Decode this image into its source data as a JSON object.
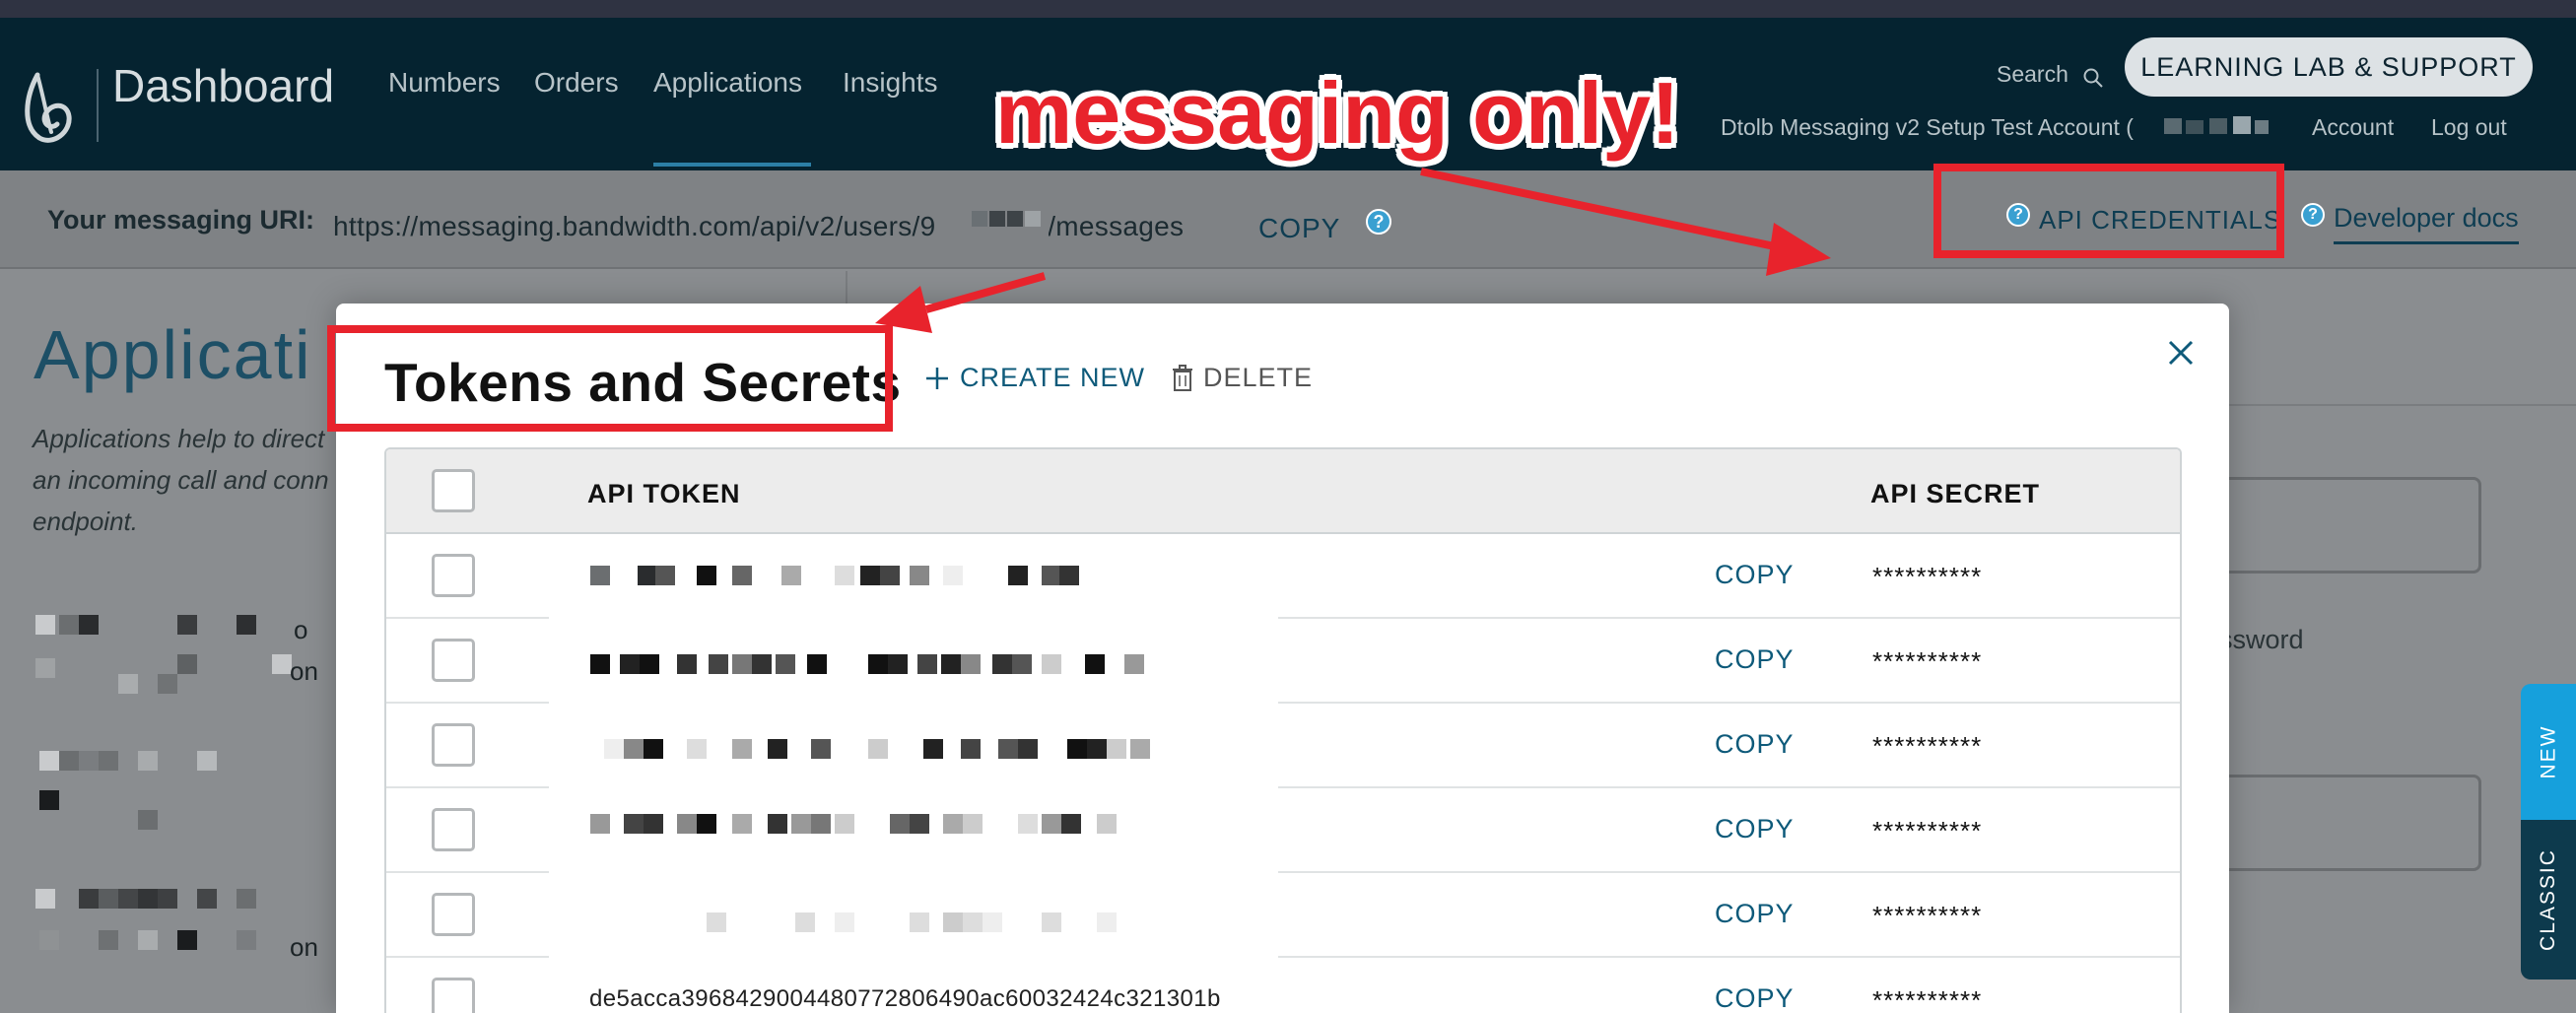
{
  "topnav": {
    "brand": "Dashboard",
    "items": [
      "Numbers",
      "Orders",
      "Applications",
      "Insights"
    ],
    "active_item": "Applications",
    "search_label": "Search",
    "learning_button": "LEARNING LAB & SUPPORT",
    "account_name": "Dtolb Messaging v2 Setup Test Account (",
    "account_link": "Account",
    "logout_link": "Log out"
  },
  "uri_bar": {
    "label": "Your messaging URI:",
    "uri_start": "https://messaging.bandwidth.com/api/v2/users/9",
    "uri_end": "78/messages",
    "copy_label": "COPY",
    "api_credentials": "API CREDENTIALS",
    "developer_docs": "Developer docs"
  },
  "background_page": {
    "title": "Applicati",
    "description": "Applications help to direct an incoming call and conn endpoint.",
    "list_items": [
      "o",
      "on",
      "on"
    ],
    "password_fragment": "ssword"
  },
  "side_tabs": {
    "new": "NEW",
    "classic": "CLASSIC"
  },
  "modal": {
    "title": "Tokens and Secrets",
    "create_new": "CREATE NEW",
    "delete": "DELETE",
    "columns": [
      "API TOKEN",
      "API SECRET"
    ],
    "rows": [
      {
        "copy": "COPY",
        "secret": "**********"
      },
      {
        "copy": "COPY",
        "secret": "**********"
      },
      {
        "copy": "COPY",
        "secret": "**********"
      },
      {
        "copy": "COPY",
        "secret": "**********"
      },
      {
        "copy": "COPY",
        "secret": "**********"
      },
      {
        "copy": "COPY",
        "secret": "**********",
        "token": "de5acca3968429004480772806490ac60032424c321301b"
      }
    ]
  },
  "annotation": {
    "text": "messaging only!",
    "color": "#e8232c"
  },
  "colors": {
    "nav_bg": "#052330",
    "accent": "#0e5a7a",
    "tab_new": "#16a0dc",
    "tab_classic": "#0d3a4d"
  }
}
